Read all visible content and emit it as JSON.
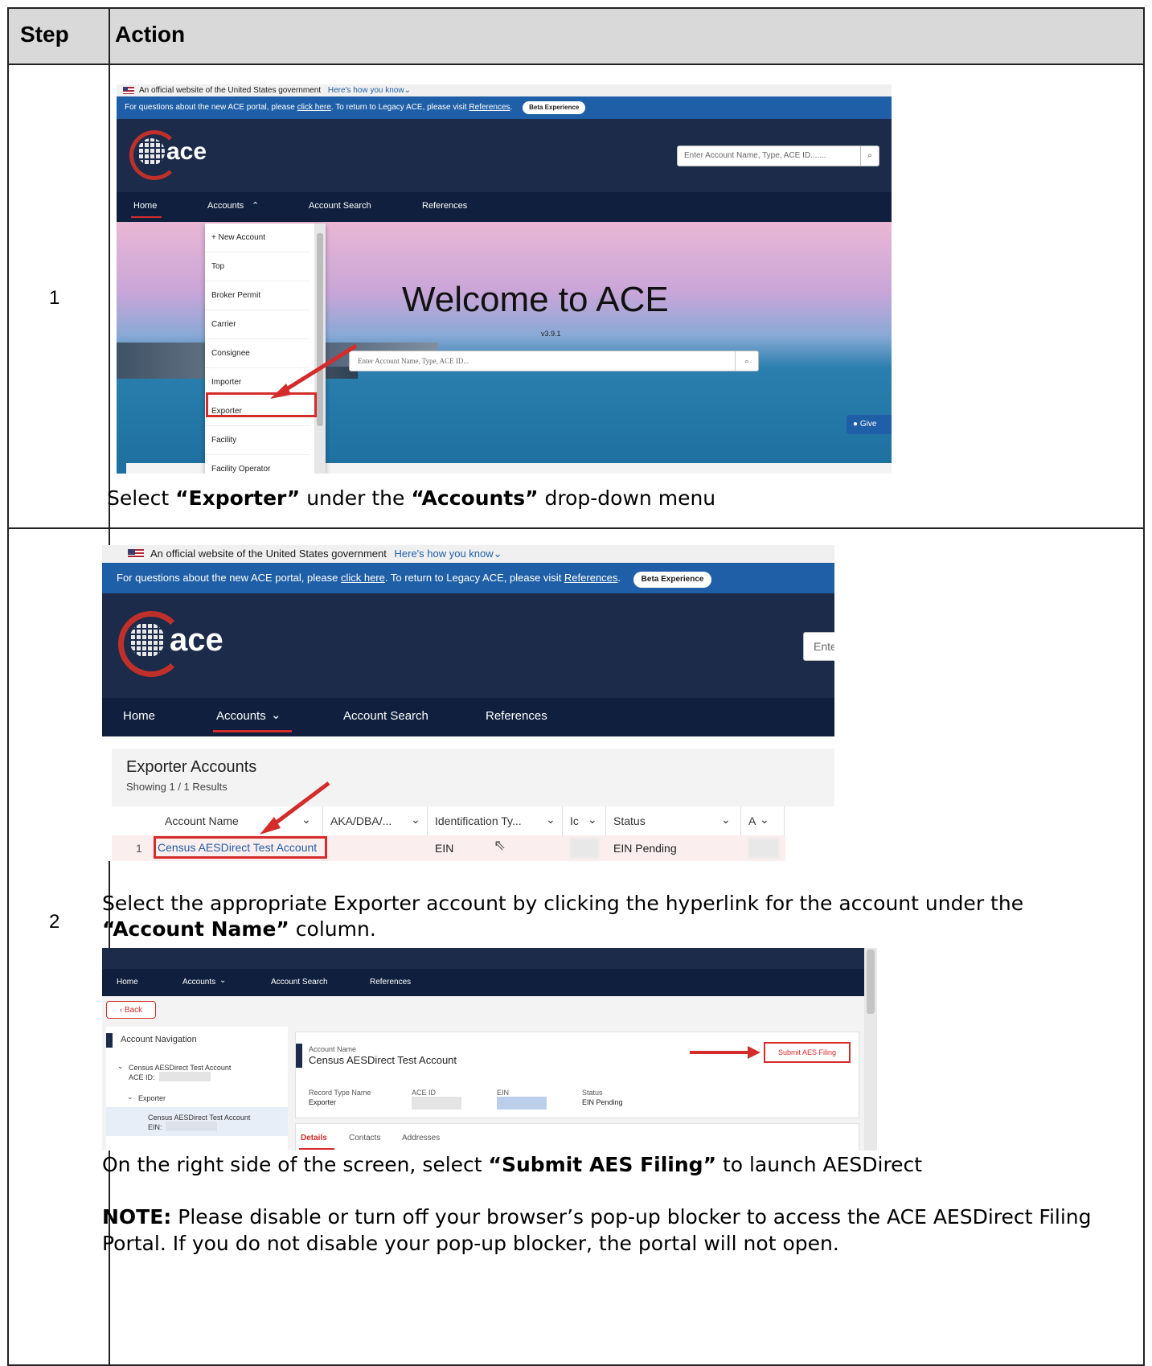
{
  "table": {
    "headers": {
      "step": "Step",
      "action": "Action"
    },
    "rows": [
      {
        "step": "1",
        "caption": {
          "pre": "Select ",
          "b1": "“Exporter”",
          "mid": " under the ",
          "b2": "“Accounts”",
          "post": " drop-down menu"
        }
      },
      {
        "step": "2",
        "caption1": {
          "line1": "Select the appropriate Exporter account by clicking the hyperlink for the account under the",
          "b": "“Account Name”",
          "post": " column."
        },
        "caption2": {
          "pre": "On the right side of the screen, select ",
          "b": "“Submit AES Filing”",
          "post": " to launch AESDirect"
        },
        "note": {
          "b": "NOTE:",
          "line1": " Please disable or turn off your browser’s pop-up blocker to access the ACE AESDirect Filing",
          "line2": "Portal. If you do not disable your pop-up blocker, the portal will not open."
        }
      }
    ]
  },
  "screenshot1": {
    "gov_banner": "An official website of the United States government",
    "how_know": "Here's how you know",
    "blue_bar": {
      "pre": "For questions about the new ACE portal, please ",
      "link1": "click here",
      "mid": ".   To return to Legacy ACE, please visit ",
      "link2": "References",
      "end": ".",
      "beta": "Beta Experience"
    },
    "logo": "ace",
    "search_placeholder": "Enter Account Name, Type, ACE ID.......",
    "nav": [
      "Home",
      "Accounts",
      "Account Search",
      "References"
    ],
    "dropdown": [
      "+ New Account",
      "Top",
      "Broker Permit",
      "Carrier",
      "Consignee",
      "Importer",
      "Exporter",
      "Facility",
      "Facility Operator"
    ],
    "hero_title": "Welcome to ACE",
    "version": "v3.9.1",
    "hero_search": "Enter Account Name, Type, ACE ID...",
    "give": "Give"
  },
  "screenshot2": {
    "gov_banner": "An official website of the United States government",
    "how_know": "Here's how you know",
    "blue_bar": {
      "pre": "For questions about the new ACE portal, please ",
      "link1": "click here",
      "mid": ".   To return to Legacy ACE, please visit ",
      "link2": "References",
      "end": ".",
      "beta": "Beta Experience"
    },
    "logo": "ace",
    "search_partial": "Ente",
    "nav": [
      "Home",
      "Accounts",
      "Account Search",
      "References"
    ],
    "list_title": "Exporter Accounts",
    "list_sub": "Showing 1 / 1 Results",
    "columns": [
      "Account Name",
      "AKA/DBA/...",
      "Identification Ty...",
      "Ic",
      "Status",
      "A"
    ],
    "row": {
      "num": "1",
      "name": "Census AESDirect Test Account",
      "id_type": "EIN",
      "status": "EIN Pending"
    }
  },
  "screenshot3": {
    "nav": [
      "Home",
      "Accounts",
      "Account Search",
      "References"
    ],
    "back": "Back",
    "nav_title": "Account Navigation",
    "tree": {
      "account": "Census AESDirect Test Account",
      "ace_id": "ACE ID:",
      "exporter": "Exporter",
      "sub_account": "Census AESDirect Test Account",
      "ein": "EIN:"
    },
    "record_label": "Account Name",
    "record_name": "Census AESDirect Test Account",
    "submit": "Submit AES Filing",
    "fields": [
      {
        "label": "Record Type Name",
        "value": "Exporter"
      },
      {
        "label": "ACE ID",
        "value": ""
      },
      {
        "label": "EIN",
        "value": ""
      },
      {
        "label": "Status",
        "value": "EIN Pending"
      }
    ],
    "tabs": [
      "Details",
      "Contacts",
      "Addresses"
    ]
  }
}
